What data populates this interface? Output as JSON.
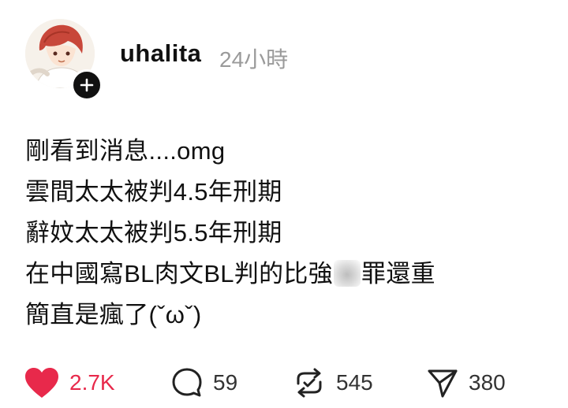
{
  "post": {
    "username": "uhalita",
    "timestamp": "24小時",
    "lines": [
      "剛看到消息....omg",
      "雲間太太被判4.5年刑期",
      "辭妏太太被判5.5年刑期",
      "在中國寫BL肉文BL判的比強",
      "簡直是瘋了(ˇωˇ)"
    ],
    "line4_tail": "罪還重"
  },
  "actions": {
    "likes": "2.7K",
    "comments": "59",
    "reposts": "545",
    "shares": "380"
  },
  "colors": {
    "like_red": "#e8294b",
    "text": "#111111",
    "muted": "#9a9a9a"
  },
  "icons": {
    "like": "heart-icon",
    "comment": "comment-bubble-icon",
    "repost": "repost-icon",
    "share": "send-icon",
    "follow": "plus-icon"
  }
}
